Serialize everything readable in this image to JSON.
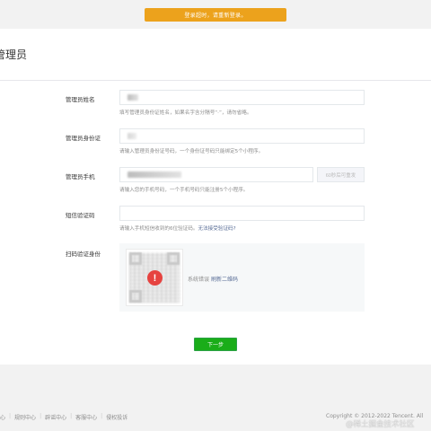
{
  "toast": {
    "text": "登录超时，请重新登录。"
  },
  "header": {
    "title": "管理员"
  },
  "form": {
    "name": {
      "label": "管理员姓名",
      "hint": "填写管理员身份证姓名，如果名字含分隔号“·”，请勿省略。"
    },
    "id_card": {
      "label": "管理员身份证",
      "placeholder": "",
      "hint": "请输入管理员身份证号码，一个身份证号码只能绑定5个小程序。"
    },
    "phone": {
      "label": "管理员手机",
      "sms_button": "60秒后可重发",
      "hint": "请输入您的手机号码，一个手机号码只能注册5个小程序。"
    },
    "sms_code": {
      "label": "短信验证码",
      "hint": "请输入手机短信收到的6位验证码。",
      "hint_link": "无法接受验证码?"
    },
    "qr": {
      "label": "扫码验证身份",
      "error_text": "系统错误",
      "refresh_link": "刷新二维码"
    },
    "next_button": "下一步"
  },
  "footer": {
    "links": [
      "中心",
      "规则中心",
      "辟谣中心",
      "客服中心",
      "侵权投诉"
    ],
    "copyright": "Copyright © 2012-2022 Tencent. All"
  },
  "watermark": "@稀土掘金技术社区",
  "colors": {
    "toast": "#eca21c",
    "primary_button": "#1aad19",
    "link": "#576b95",
    "error": "#e64340"
  }
}
